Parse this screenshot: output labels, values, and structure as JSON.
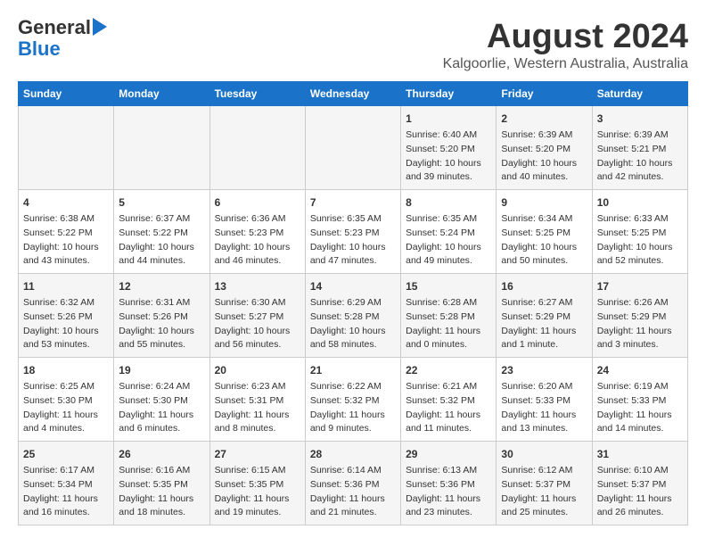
{
  "logo": {
    "line1": "General",
    "line2": "Blue"
  },
  "title": "August 2024",
  "subtitle": "Kalgoorlie, Western Australia, Australia",
  "headers": [
    "Sunday",
    "Monday",
    "Tuesday",
    "Wednesday",
    "Thursday",
    "Friday",
    "Saturday"
  ],
  "weeks": [
    [
      {
        "day": "",
        "info": ""
      },
      {
        "day": "",
        "info": ""
      },
      {
        "day": "",
        "info": ""
      },
      {
        "day": "",
        "info": ""
      },
      {
        "day": "1",
        "info": "Sunrise: 6:40 AM\nSunset: 5:20 PM\nDaylight: 10 hours\nand 39 minutes."
      },
      {
        "day": "2",
        "info": "Sunrise: 6:39 AM\nSunset: 5:20 PM\nDaylight: 10 hours\nand 40 minutes."
      },
      {
        "day": "3",
        "info": "Sunrise: 6:39 AM\nSunset: 5:21 PM\nDaylight: 10 hours\nand 42 minutes."
      }
    ],
    [
      {
        "day": "4",
        "info": "Sunrise: 6:38 AM\nSunset: 5:22 PM\nDaylight: 10 hours\nand 43 minutes."
      },
      {
        "day": "5",
        "info": "Sunrise: 6:37 AM\nSunset: 5:22 PM\nDaylight: 10 hours\nand 44 minutes."
      },
      {
        "day": "6",
        "info": "Sunrise: 6:36 AM\nSunset: 5:23 PM\nDaylight: 10 hours\nand 46 minutes."
      },
      {
        "day": "7",
        "info": "Sunrise: 6:35 AM\nSunset: 5:23 PM\nDaylight: 10 hours\nand 47 minutes."
      },
      {
        "day": "8",
        "info": "Sunrise: 6:35 AM\nSunset: 5:24 PM\nDaylight: 10 hours\nand 49 minutes."
      },
      {
        "day": "9",
        "info": "Sunrise: 6:34 AM\nSunset: 5:25 PM\nDaylight: 10 hours\nand 50 minutes."
      },
      {
        "day": "10",
        "info": "Sunrise: 6:33 AM\nSunset: 5:25 PM\nDaylight: 10 hours\nand 52 minutes."
      }
    ],
    [
      {
        "day": "11",
        "info": "Sunrise: 6:32 AM\nSunset: 5:26 PM\nDaylight: 10 hours\nand 53 minutes."
      },
      {
        "day": "12",
        "info": "Sunrise: 6:31 AM\nSunset: 5:26 PM\nDaylight: 10 hours\nand 55 minutes."
      },
      {
        "day": "13",
        "info": "Sunrise: 6:30 AM\nSunset: 5:27 PM\nDaylight: 10 hours\nand 56 minutes."
      },
      {
        "day": "14",
        "info": "Sunrise: 6:29 AM\nSunset: 5:28 PM\nDaylight: 10 hours\nand 58 minutes."
      },
      {
        "day": "15",
        "info": "Sunrise: 6:28 AM\nSunset: 5:28 PM\nDaylight: 11 hours\nand 0 minutes."
      },
      {
        "day": "16",
        "info": "Sunrise: 6:27 AM\nSunset: 5:29 PM\nDaylight: 11 hours\nand 1 minute."
      },
      {
        "day": "17",
        "info": "Sunrise: 6:26 AM\nSunset: 5:29 PM\nDaylight: 11 hours\nand 3 minutes."
      }
    ],
    [
      {
        "day": "18",
        "info": "Sunrise: 6:25 AM\nSunset: 5:30 PM\nDaylight: 11 hours\nand 4 minutes."
      },
      {
        "day": "19",
        "info": "Sunrise: 6:24 AM\nSunset: 5:30 PM\nDaylight: 11 hours\nand 6 minutes."
      },
      {
        "day": "20",
        "info": "Sunrise: 6:23 AM\nSunset: 5:31 PM\nDaylight: 11 hours\nand 8 minutes."
      },
      {
        "day": "21",
        "info": "Sunrise: 6:22 AM\nSunset: 5:32 PM\nDaylight: 11 hours\nand 9 minutes."
      },
      {
        "day": "22",
        "info": "Sunrise: 6:21 AM\nSunset: 5:32 PM\nDaylight: 11 hours\nand 11 minutes."
      },
      {
        "day": "23",
        "info": "Sunrise: 6:20 AM\nSunset: 5:33 PM\nDaylight: 11 hours\nand 13 minutes."
      },
      {
        "day": "24",
        "info": "Sunrise: 6:19 AM\nSunset: 5:33 PM\nDaylight: 11 hours\nand 14 minutes."
      }
    ],
    [
      {
        "day": "25",
        "info": "Sunrise: 6:17 AM\nSunset: 5:34 PM\nDaylight: 11 hours\nand 16 minutes."
      },
      {
        "day": "26",
        "info": "Sunrise: 6:16 AM\nSunset: 5:35 PM\nDaylight: 11 hours\nand 18 minutes."
      },
      {
        "day": "27",
        "info": "Sunrise: 6:15 AM\nSunset: 5:35 PM\nDaylight: 11 hours\nand 19 minutes."
      },
      {
        "day": "28",
        "info": "Sunrise: 6:14 AM\nSunset: 5:36 PM\nDaylight: 11 hours\nand 21 minutes."
      },
      {
        "day": "29",
        "info": "Sunrise: 6:13 AM\nSunset: 5:36 PM\nDaylight: 11 hours\nand 23 minutes."
      },
      {
        "day": "30",
        "info": "Sunrise: 6:12 AM\nSunset: 5:37 PM\nDaylight: 11 hours\nand 25 minutes."
      },
      {
        "day": "31",
        "info": "Sunrise: 6:10 AM\nSunset: 5:37 PM\nDaylight: 11 hours\nand 26 minutes."
      }
    ]
  ]
}
